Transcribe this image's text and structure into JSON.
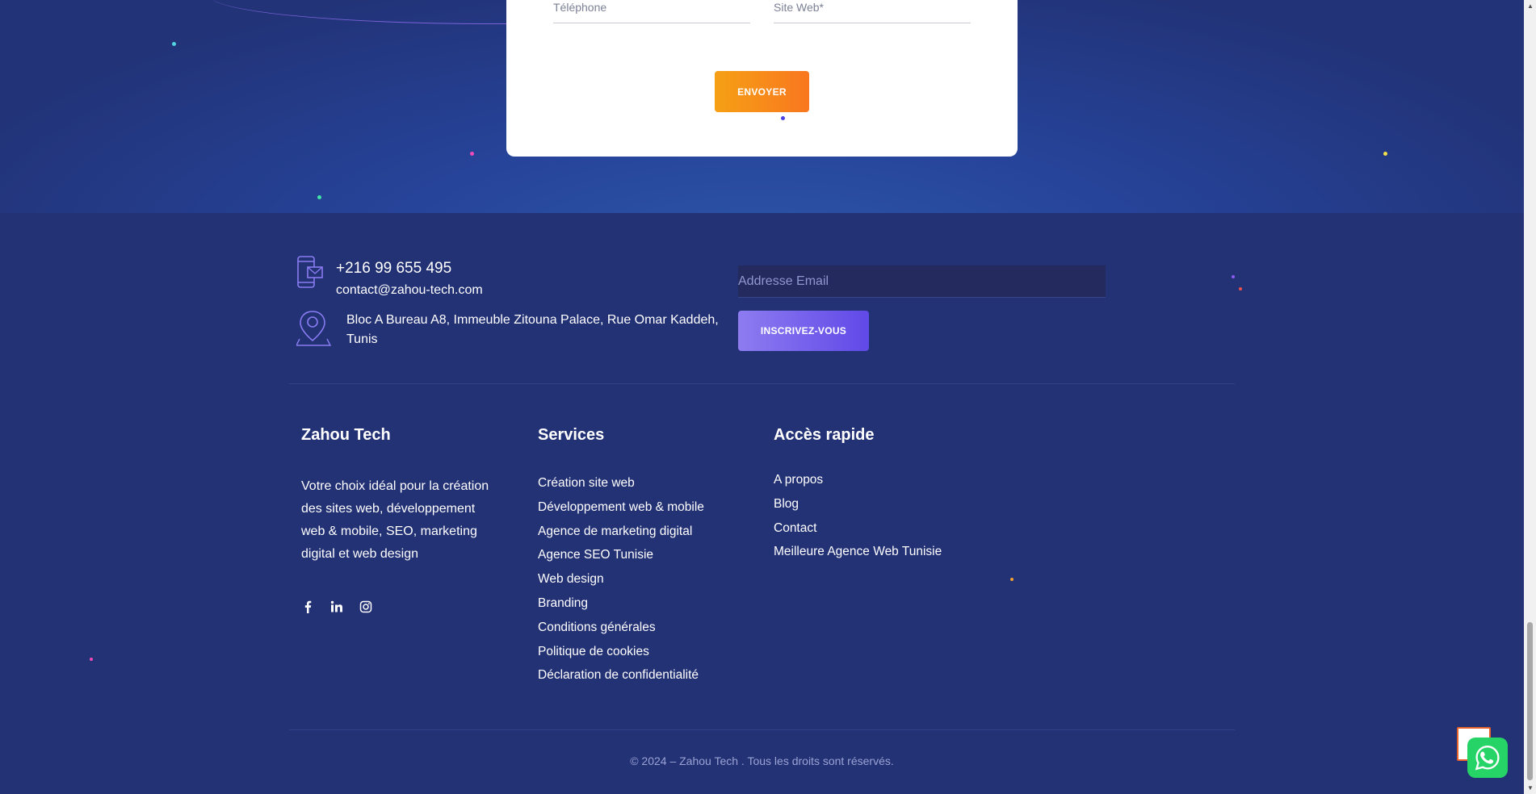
{
  "contact_form": {
    "phone_placeholder": "Téléphone",
    "website_placeholder": "Site Web*",
    "send_label": "ENVOYER"
  },
  "contact_info": {
    "phone": "+216 99 655 495",
    "email": "contact@zahou-tech.com",
    "address": "Bloc A Bureau A8, Immeuble Zitouna Palace, Rue Omar Kaddeh, Tunis"
  },
  "newsletter": {
    "email_placeholder": "Addresse Email",
    "subscribe_label": "INSCRIVEZ-VOUS"
  },
  "footer": {
    "about": {
      "title": "Zahou Tech",
      "text": "Votre choix idéal pour la création des sites web, développement web & mobile, SEO, marketing digital et web design",
      "socials": [
        "facebook-icon",
        "linkedin-icon",
        "instagram-icon"
      ]
    },
    "services": {
      "title": "Services",
      "items": [
        "Création site web",
        "Développement web & mobile",
        "Agence de marketing digital",
        "Agence SEO Tunisie",
        "Web design",
        "Branding",
        "Conditions générales",
        "Politique de cookies",
        "Déclaration de confidentialité"
      ]
    },
    "quick_access": {
      "title": "Accès rapide",
      "items": [
        "A propos",
        "Blog",
        "Contact",
        "Meilleure Agence Web Tunisie"
      ]
    },
    "copyright": "© 2024 – Zahou Tech . Tous les droits sont réservés."
  },
  "colors": {
    "background": "#233175",
    "send_button": "#f78a1a",
    "subscribe_button": "#7563ec",
    "whatsapp": "#25d366"
  }
}
